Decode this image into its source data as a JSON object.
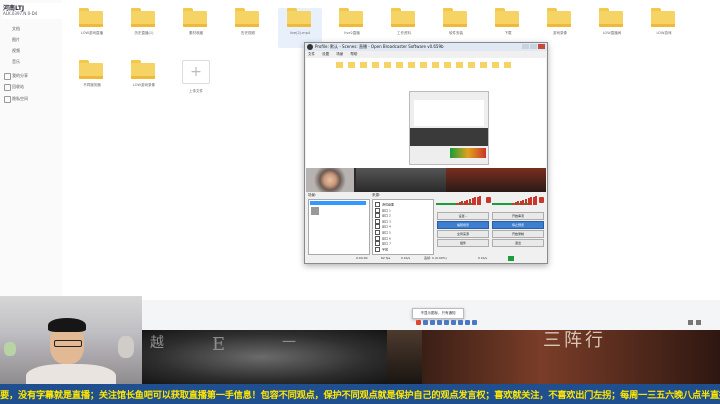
{
  "app": {
    "user_name": "河南LTJ",
    "user_sub": "ALK.0397.N.0-D4"
  },
  "sidebar": {
    "items": [
      {
        "label": "文档"
      },
      {
        "label": "图片"
      },
      {
        "label": "视频"
      },
      {
        "label": "音乐"
      },
      {
        "label": "我的分享"
      },
      {
        "label": "回收站"
      },
      {
        "label": "隐私空间"
      }
    ]
  },
  "files": {
    "row1": [
      {
        "label": "LOW游戏直播"
      },
      {
        "label": "历史直播(1)"
      },
      {
        "label": "素材收藏"
      },
      {
        "label": "历史视频"
      },
      {
        "label": "live(2).mp4"
      },
      {
        "label": "live2直播"
      },
      {
        "label": "工作资料"
      },
      {
        "label": "软件安装"
      },
      {
        "label": "下载"
      },
      {
        "label": "游戏录像"
      },
      {
        "label": "LOW直播间"
      },
      {
        "label": "LOW游戏"
      }
    ],
    "row2": [
      {
        "label": "不同服务器"
      },
      {
        "label": "LOW游戏录像"
      }
    ],
    "upload_label": "上传文件",
    "upload_glyph": "+"
  },
  "obs": {
    "title": "Profile: 默认 - Scenes: 直播 - Open Broadcaster Software v0.659b",
    "menu": [
      "文件",
      "设置",
      "场景",
      "帮助"
    ],
    "scenes_label": "场景:",
    "sources_label": "来源:",
    "sources": [
      "游戏画面",
      "窗口 1",
      "窗口 2",
      "窗口 3",
      "窗口 4",
      "窗口 5",
      "窗口 6",
      "窗口 7",
      "字幕"
    ],
    "buttons": {
      "settings": "设置...",
      "start_stream": "开始串流",
      "edit_scene": "编辑场景",
      "global_sources": "全局来源",
      "plugins": "插件",
      "start_record": "开始录制",
      "stop_preview": "停止预览",
      "exit": "退出",
      "dashboard": "仪表盘"
    },
    "status": {
      "time": "0:00:00",
      "fps": "62 fps",
      "bitrate": "0 kb/s",
      "dropped": "丢帧: 0 (0.00%)",
      "disk": "0 kb/s"
    }
  },
  "tooltip": "不显示图标，只有通知",
  "banner": {
    "title": "三阵行",
    "glyphs": [
      "越",
      "E",
      "一"
    ]
  },
  "ticker": "要，没有字幕就是直播；关注馆长鱼吧可以获取直播第一手信息！包容不同观点，保护不同观点就是保护自己的观点发言权；喜欢就关注，不喜欢出门左拐；每周一三五六晚八点半直播，有滚动字幕就是录"
}
